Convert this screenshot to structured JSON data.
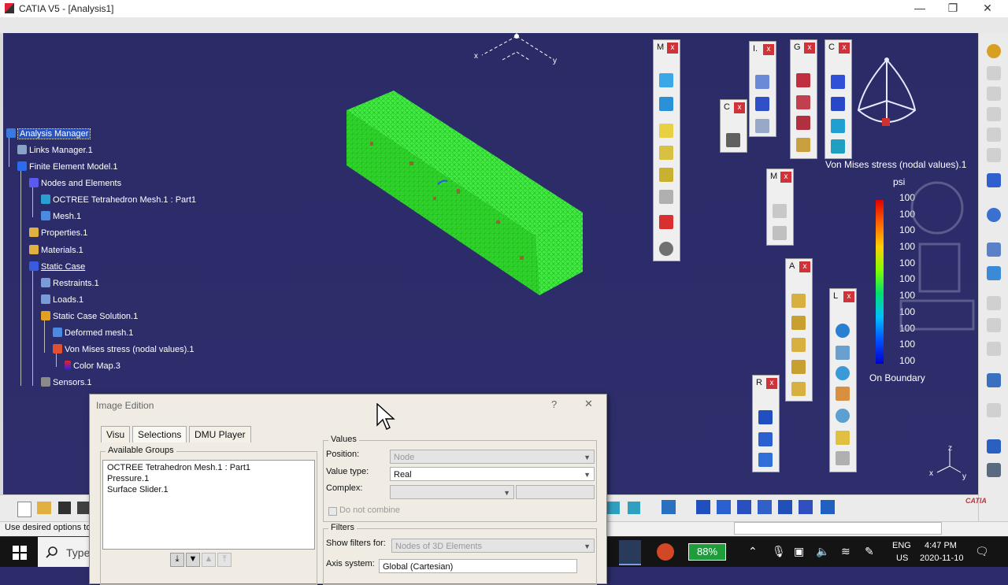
{
  "window": {
    "title": "CATIA V5 - [Analysis1]",
    "controls": {
      "minimize": "—",
      "restore": "❐",
      "close": "✕"
    }
  },
  "compass": {
    "x_label": "x",
    "y_label": "y"
  },
  "tree": {
    "items": [
      {
        "label": "Analysis Manager"
      },
      {
        "label": "Links Manager.1"
      },
      {
        "label": "Finite Element Model.1"
      },
      {
        "label": "Nodes and Elements"
      },
      {
        "label": "OCTREE Tetrahedron Mesh.1 : Part1"
      },
      {
        "label": "Mesh.1"
      },
      {
        "label": "Properties.1"
      },
      {
        "label": "Materials.1"
      },
      {
        "label": "Static Case"
      },
      {
        "label": "Restraints.1"
      },
      {
        "label": "Loads.1"
      },
      {
        "label": "Static Case Solution.1"
      },
      {
        "label": "Deformed mesh.1"
      },
      {
        "label": "Von Mises stress (nodal values).1"
      },
      {
        "label": "Color Map.3"
      },
      {
        "label": "Sensors.1"
      }
    ]
  },
  "toolbars": {
    "m1": "M",
    "i": "I.",
    "g": "G",
    "c1": "C",
    "c2": "C",
    "m2": "M",
    "a": "A",
    "l": "L",
    "r": "R",
    "close": "x"
  },
  "legend": {
    "title": "Von Mises stress (nodal values).1",
    "unit": "psi",
    "values": [
      "100",
      "100",
      "100",
      "100",
      "100",
      "100",
      "100",
      "100",
      "100",
      "100",
      "100"
    ],
    "footer": "On Boundary"
  },
  "axis_triad": {
    "x": "x",
    "y": "y",
    "z": "z"
  },
  "brand": "CATIA",
  "status": {
    "text": "Use desired options to"
  },
  "dialog": {
    "title": "Image Edition",
    "help": "?",
    "close": "✕",
    "tabs": [
      "Visu",
      "Selections",
      "DMU Player"
    ],
    "available_groups": {
      "label": "Available Groups",
      "items": [
        "OCTREE Tetrahedron Mesh.1 : Part1",
        "Pressure.1",
        "Surface Slider.1"
      ]
    },
    "values": {
      "label": "Values",
      "position_label": "Position:",
      "position_value": "Node",
      "value_type_label": "Value type:",
      "value_type_value": "Real",
      "complex_label": "Complex:",
      "do_not_combine": "Do not combine"
    },
    "filters": {
      "label": "Filters",
      "show_filters_label": "Show filters for:",
      "show_filters_value": "Nodes of 3D Elements",
      "axis_system_label": "Axis system:",
      "axis_system_value": "Global (Cartesian)"
    }
  },
  "taskbar": {
    "search_placeholder": "Type",
    "battery": "88%",
    "lang_top": "ENG",
    "lang_bottom": "US",
    "time": "4:47 PM",
    "date": "2020-11-10"
  },
  "colors": {
    "mesh": "#2cff2c",
    "viewport": "#2c2c6a",
    "toolbar_close": "#d0323a",
    "battery": "#1e9e3a"
  }
}
